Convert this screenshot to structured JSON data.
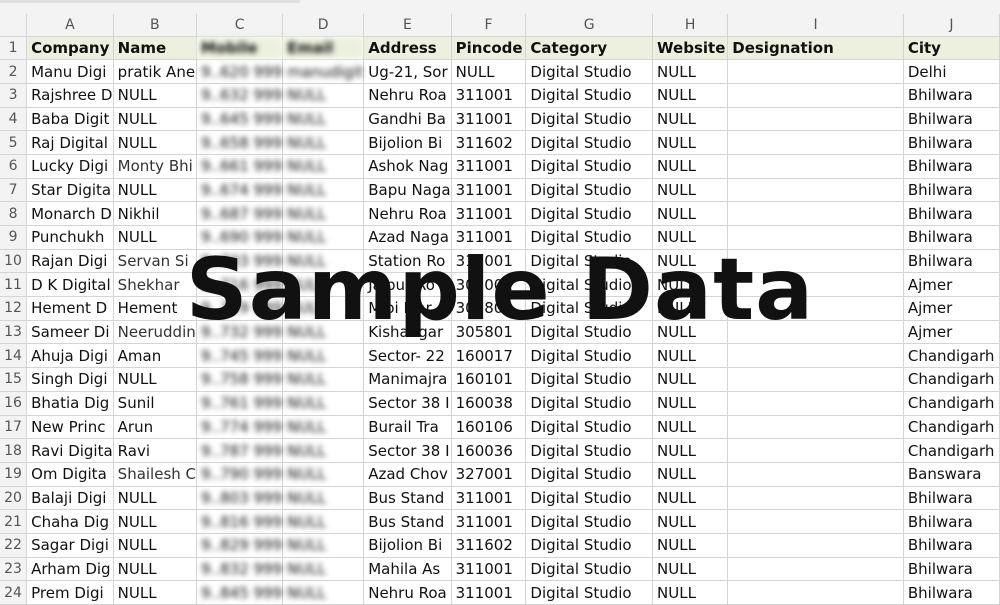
{
  "columns": [
    "A",
    "B",
    "C",
    "D",
    "E",
    "F",
    "G",
    "H",
    "I",
    "J"
  ],
  "headers": [
    "Company",
    "Name",
    "Mobile",
    "Email",
    "Address",
    "Pincode",
    "Category",
    "Website",
    "Designation",
    "City"
  ],
  "rows": [
    [
      "Manu Digi",
      "pratik Ane",
      "9..620 999",
      "manudigit",
      "Ug-21, Sor",
      "NULL",
      "Digital Studio",
      "NULL",
      "",
      "Delhi"
    ],
    [
      "Rajshree D",
      "NULL",
      "9..632 999",
      "NULL",
      "Nehru Roa",
      "311001",
      "Digital Studio",
      "NULL",
      "",
      "Bhilwara"
    ],
    [
      "Baba Digit",
      "NULL",
      "9..645 999",
      "NULL",
      "Gandhi Ba",
      "311001",
      "Digital Studio",
      "NULL",
      "",
      "Bhilwara"
    ],
    [
      "Raj Digital",
      "NULL",
      "9..658 999",
      "NULL",
      "Bijolion Bi",
      "311602",
      "Digital Studio",
      "NULL",
      "",
      "Bhilwara"
    ],
    [
      "Lucky Digi",
      "Monty Bhi",
      "9..661 999",
      "NULL",
      "Ashok Nag",
      "311001",
      "Digital Studio",
      "NULL",
      "",
      "Bhilwara"
    ],
    [
      "Star Digita",
      "NULL",
      "9..674 999",
      "NULL",
      "Bapu Naga",
      "311001",
      "Digital Studio",
      "NULL",
      "",
      "Bhilwara"
    ],
    [
      "Monarch D",
      "Nikhil",
      "9..687 999",
      "NULL",
      "Nehru Roa",
      "311001",
      "Digital Studio",
      "NULL",
      "",
      "Bhilwara"
    ],
    [
      "Punchukh",
      "NULL",
      "9..690 999",
      "NULL",
      "Azad Naga",
      "311001",
      "Digital Studio",
      "NULL",
      "",
      "Bhilwara"
    ],
    [
      "Rajan Digi",
      "Servan Si",
      "9..703 999",
      "NULL",
      "Station Ro",
      "311001",
      "Digital Studio",
      "NULL",
      "",
      "Bhilwara"
    ],
    [
      "D K Digital",
      "Shekhar",
      "9..716 999",
      "NULL",
      "Jaipur Ro",
      "305001",
      "Digital Studio",
      "NULL",
      "",
      "Ajmer"
    ],
    [
      "Hement D",
      "Hement",
      "9..729 999",
      "NULL",
      "Mloi Mar",
      "305801",
      "Digital Studio",
      "NULL",
      "",
      "Ajmer"
    ],
    [
      "Sameer Di",
      "Neeruddin",
      "9..732 999",
      "NULL",
      "Kishangar",
      "305801",
      "Digital Studio",
      "NULL",
      "",
      "Ajmer"
    ],
    [
      "Ahuja Digi",
      "Aman",
      "9..745 999",
      "NULL",
      "Sector- 22",
      "160017",
      "Digital Studio",
      "NULL",
      "",
      "Chandigarh"
    ],
    [
      "Singh Digi",
      "NULL",
      "9..758 999",
      "NULL",
      "Manimajra",
      "160101",
      "Digital Studio",
      "NULL",
      "",
      "Chandigarh"
    ],
    [
      "Bhatia Dig",
      "Sunil",
      "9..761 999",
      "NULL",
      "Sector 38 I",
      "160038",
      "Digital Studio",
      "NULL",
      "",
      "Chandigarh"
    ],
    [
      "New Princ",
      "Arun",
      "9..774 999",
      "NULL",
      "Burail Tra",
      "160106",
      "Digital Studio",
      "NULL",
      "",
      "Chandigarh"
    ],
    [
      "Ravi Digita",
      "Ravi",
      "9..787 999",
      "NULL",
      "Sector 38 I",
      "160036",
      "Digital Studio",
      "NULL",
      "",
      "Chandigarh"
    ],
    [
      "Om Digita",
      "Shailesh C",
      "9..790 999",
      "NULL",
      "Azad Chov",
      "327001",
      "Digital Studio",
      "NULL",
      "",
      "Banswara"
    ],
    [
      "Balaji Digi",
      "NULL",
      "9..803 999",
      "NULL",
      "Bus Stand",
      "311001",
      "Digital Studio",
      "NULL",
      "",
      "Bhilwara"
    ],
    [
      "Chaha Dig",
      "NULL",
      "9..816 999",
      "NULL",
      "Bus Stand",
      "311001",
      "Digital Studio",
      "NULL",
      "",
      "Bhilwara"
    ],
    [
      "Sagar Digi",
      "NULL",
      "9..829 999",
      "NULL",
      "Bijolion Bi",
      "311602",
      "Digital Studio",
      "NULL",
      "",
      "Bhilwara"
    ],
    [
      "Arham Dig",
      "NULL",
      "9..832 999",
      "NULL",
      "Mahila As",
      "311001",
      "Digital Studio",
      "NULL",
      "",
      "Bhilwara"
    ],
    [
      "Prem Digi",
      "NULL",
      "9..845 999",
      "NULL",
      "Nehru Roa",
      "311001",
      "Digital Studio",
      "NULL",
      "",
      "Bhilwara"
    ]
  ],
  "watermark": "Sample Data"
}
